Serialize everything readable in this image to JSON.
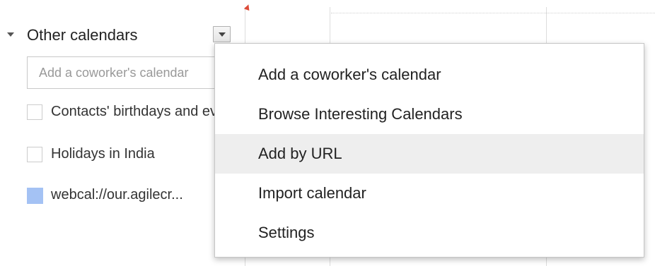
{
  "sidebar": {
    "section_title": "Other calendars",
    "coworker_input": {
      "value": "",
      "placeholder": "Add a coworker's calendar"
    },
    "calendars": [
      {
        "label": "Contacts' birthdays and events",
        "checked": false
      },
      {
        "label": "Holidays in India",
        "checked": false
      },
      {
        "label": "webcal://our.agilecr...",
        "checked": true,
        "color": "#a4c2f4"
      }
    ]
  },
  "menu": {
    "items": [
      {
        "label": "Add a coworker's calendar",
        "highlighted": false
      },
      {
        "label": "Browse Interesting Calendars",
        "highlighted": false
      },
      {
        "label": "Add by URL",
        "highlighted": true
      },
      {
        "label": "Import calendar",
        "highlighted": false
      },
      {
        "label": "Settings",
        "highlighted": false
      }
    ]
  },
  "colors": {
    "highlight": "#eeeeee",
    "now_marker": "#dd4b39",
    "calendar_swatch": "#a4c2f4"
  }
}
